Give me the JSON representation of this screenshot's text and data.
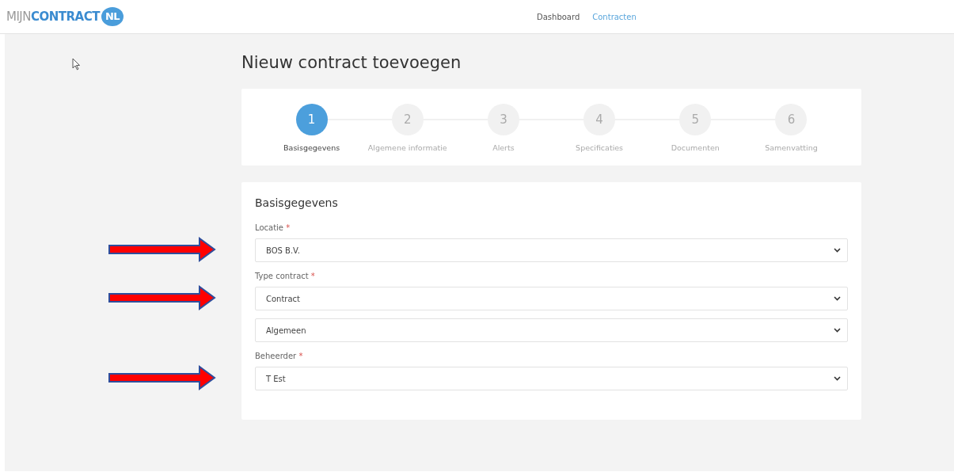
{
  "logo": {
    "light": "MIJN",
    "bold": "CONTRACT",
    "badge": "NL"
  },
  "nav": [
    {
      "label": "Dashboard",
      "selected": false
    },
    {
      "label": "Contracten",
      "selected": true
    }
  ],
  "title": "Nieuw contract toevoegen",
  "steps": [
    {
      "number": "1",
      "label": "Basisgegevens",
      "selected": true
    },
    {
      "number": "2",
      "label": "Algemene informatie",
      "selected": false
    },
    {
      "number": "3",
      "label": "Alerts",
      "selected": false
    },
    {
      "number": "4",
      "label": "Specificaties",
      "selected": false
    },
    {
      "number": "5",
      "label": "Documenten",
      "selected": false
    },
    {
      "number": "6",
      "label": "Samenvatting",
      "selected": false
    }
  ],
  "form": {
    "heading": "Basisgegevens",
    "fields": [
      {
        "label": "Locatie",
        "required_mark": "*",
        "value": "BOS B.V.",
        "annotated": true
      },
      {
        "label": "Type contract",
        "required_mark": "*",
        "value": "Contract",
        "annotated": true
      },
      {
        "value": "Algemeen",
        "annotated": false
      },
      {
        "label": "Beheerder",
        "required_mark": "*",
        "value": "T Est",
        "annotated": true
      }
    ]
  }
}
